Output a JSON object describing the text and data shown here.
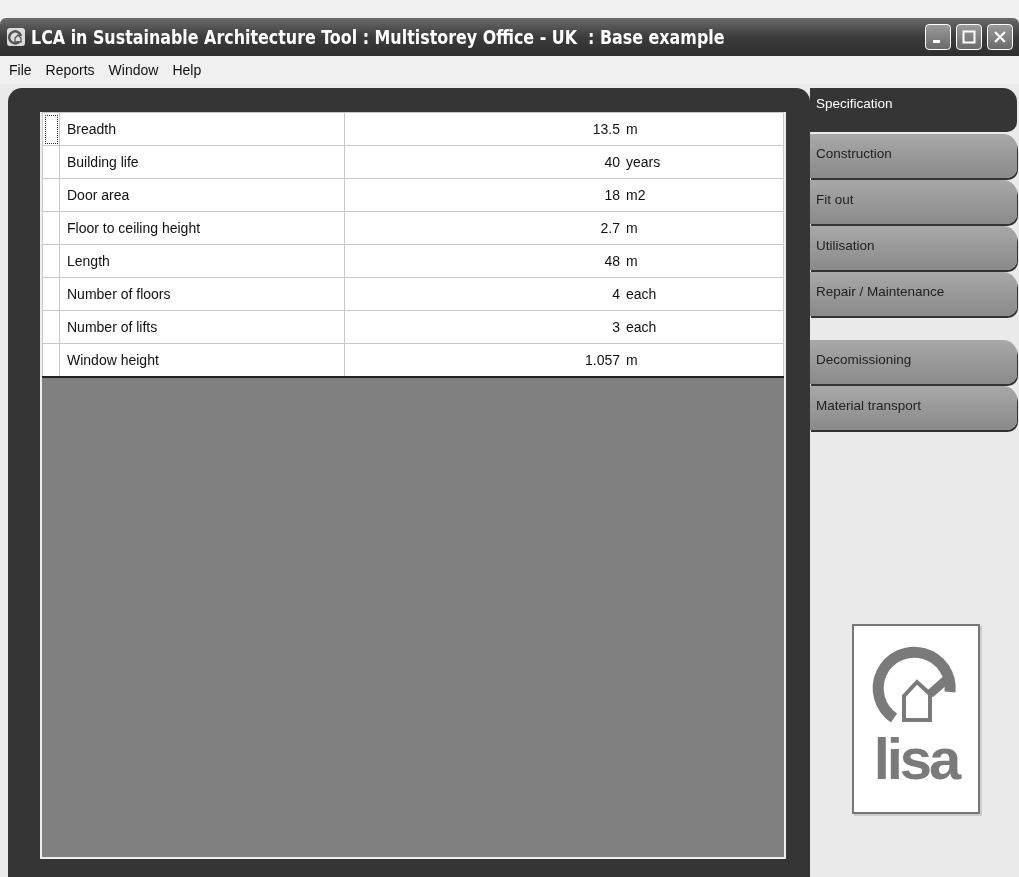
{
  "window": {
    "title": "LCA in Sustainable Architecture Tool : Multistorey Office - UK  : Base example"
  },
  "menu": [
    "File",
    "Reports",
    "Window",
    "Help"
  ],
  "table": {
    "rows": [
      {
        "name": "Breadth",
        "value": "13.5",
        "unit": "m",
        "selected": true
      },
      {
        "name": "Building life",
        "value": "40",
        "unit": "years",
        "selected": false
      },
      {
        "name": "Door area",
        "value": "18",
        "unit": "m2",
        "selected": false
      },
      {
        "name": "Floor to ceiling height",
        "value": "2.7",
        "unit": "m",
        "selected": false
      },
      {
        "name": "Length",
        "value": "48",
        "unit": "m",
        "selected": false
      },
      {
        "name": "Number of floors",
        "value": "4",
        "unit": "each",
        "selected": false
      },
      {
        "name": "Number of lifts",
        "value": "3",
        "unit": "each",
        "selected": false
      },
      {
        "name": "Window height",
        "value": "1.057",
        "unit": "m",
        "selected": false
      }
    ]
  },
  "tab_groups": [
    {
      "tabs": [
        {
          "label": "Specification",
          "selected": true
        },
        {
          "label": "Construction",
          "selected": false
        },
        {
          "label": "Fit out",
          "selected": false
        },
        {
          "label": "Utilisation",
          "selected": false
        },
        {
          "label": "Repair / Maintenance",
          "selected": false
        }
      ]
    },
    {
      "tabs": [
        {
          "label": "Decomissioning",
          "selected": false
        },
        {
          "label": "Material transport",
          "selected": false
        }
      ]
    }
  ],
  "logo": {
    "text": "lisa"
  }
}
